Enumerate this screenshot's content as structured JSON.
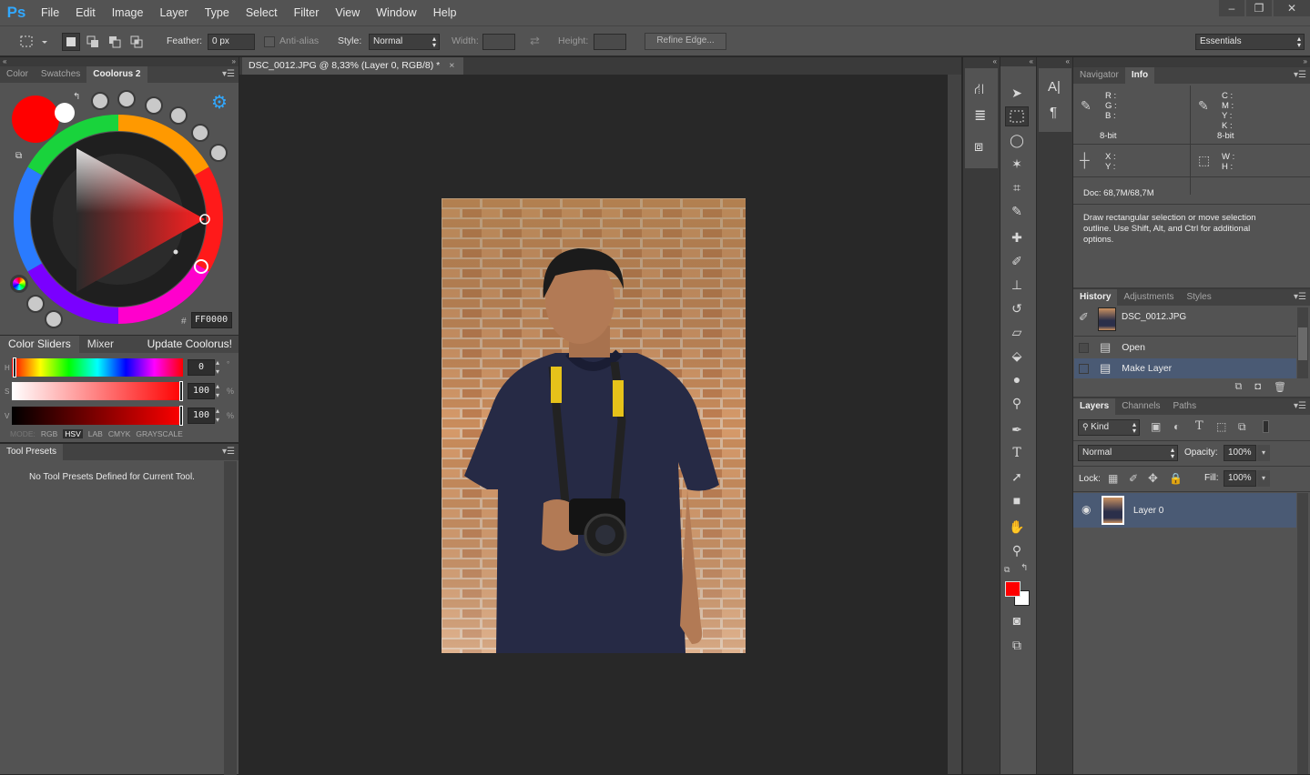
{
  "app": {
    "logo": "Ps"
  },
  "menu": [
    "File",
    "Edit",
    "Image",
    "Layer",
    "Type",
    "Select",
    "Filter",
    "View",
    "Window",
    "Help"
  ],
  "window_controls": [
    "–",
    "❐",
    "✕"
  ],
  "options": {
    "feather_label": "Feather:",
    "feather_value": "0 px",
    "antialias_label": "Anti-alias",
    "style_label": "Style:",
    "style_value": "Normal",
    "width_label": "Width:",
    "height_label": "Height:",
    "refine_edge": "Refine Edge...",
    "workspace": "Essentials"
  },
  "left_tabs": [
    "Color",
    "Swatches",
    "Coolorus 2"
  ],
  "coolorus": {
    "hex_prefix": "#",
    "hex_value": "FF0000",
    "fg_color": "#ff0000",
    "bg_color": "#ffffff"
  },
  "sliders_tabs": {
    "color_sliders": "Color Sliders",
    "mixer": "Mixer",
    "update": "Update Coolorus!"
  },
  "sliders": [
    {
      "letter": "H",
      "value": "0",
      "unit": "°"
    },
    {
      "letter": "S",
      "value": "100",
      "unit": "%"
    },
    {
      "letter": "V",
      "value": "100",
      "unit": "%"
    }
  ],
  "modes": {
    "label": "MODE:",
    "items": [
      "RGB",
      "HSV",
      "LAB",
      "CMYK",
      "GRAYSCALE"
    ],
    "active": "HSV"
  },
  "tool_presets": {
    "tab": "Tool Presets",
    "empty": "No Tool Presets Defined for Current Tool."
  },
  "document": {
    "tab_title": "DSC_0012.JPG @ 8,33% (Layer 0, RGB/8) *",
    "close": "×"
  },
  "info_tabs": [
    "Navigator",
    "Info"
  ],
  "info": {
    "rgb": [
      "R :",
      "G :",
      "B :"
    ],
    "cmyk": [
      "C :",
      "M :",
      "Y :",
      "K :"
    ],
    "bit1": "8-bit",
    "bit2": "8-bit",
    "xy": [
      "X :",
      "Y :"
    ],
    "wh": [
      "W :",
      "H :"
    ],
    "doc": "Doc: 68,7M/68,7M",
    "hint": "Draw rectangular selection or move selection outline.  Use Shift, Alt, and Ctrl for additional options."
  },
  "history_tabs": [
    "History",
    "Adjustments",
    "Styles"
  ],
  "history": {
    "snapshot": "DSC_0012.JPG",
    "items": [
      "Open",
      "Make Layer"
    ]
  },
  "layers_tabs": [
    "Layers",
    "Channels",
    "Paths"
  ],
  "layers": {
    "kind": "Kind",
    "blend": "Normal",
    "opacity_label": "Opacity:",
    "opacity": "100%",
    "lock_label": "Lock:",
    "fill_label": "Fill:",
    "fill": "100%",
    "layer_name": "Layer 0"
  },
  "colors": {
    "fg": "#ff0000",
    "bg": "#ffffff",
    "accent": "#31a8ff"
  }
}
